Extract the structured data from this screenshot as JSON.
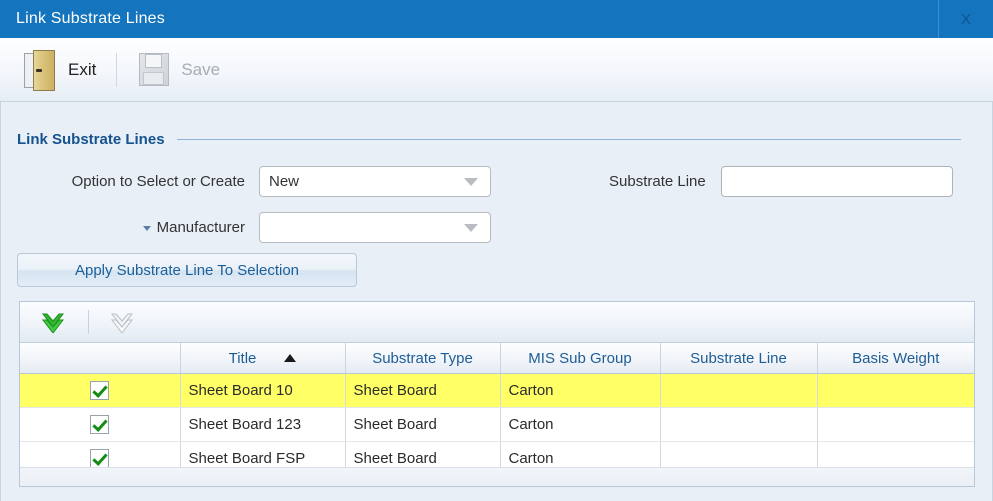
{
  "window": {
    "title": "Link Substrate Lines",
    "close_label": "X",
    "accent_color": "#1474bd",
    "body_background": "#e8eff7"
  },
  "toolbar": {
    "exit_label": "Exit",
    "exit_icon": "door-open-icon",
    "save_label": "Save",
    "save_icon": "floppy-disk-icon",
    "save_disabled": true
  },
  "form": {
    "section_title": "Link Substrate Lines",
    "option_label": "Option to Select or Create",
    "option_value": "New",
    "manufacturer_label": "Manufacturer",
    "manufacturer_value": "",
    "substrate_line_label": "Substrate Line",
    "substrate_line_value": "",
    "substrate_line_placeholder": "",
    "apply_button_label": "Apply Substrate Line To Selection"
  },
  "grid": {
    "toolbar": {
      "select_all_icon": "double-check-green-icon",
      "deselect_all_icon": "double-check-grey-icon",
      "deselect_all_disabled": true
    },
    "columns": [
      {
        "key": "checkbox",
        "label": ""
      },
      {
        "key": "title",
        "label": "Title",
        "sort": "asc"
      },
      {
        "key": "substrate_type",
        "label": "Substrate Type"
      },
      {
        "key": "mis_sub_group",
        "label": "MIS Sub Group"
      },
      {
        "key": "substrate_line",
        "label": "Substrate Line"
      },
      {
        "key": "basis_weight",
        "label": "Basis Weight"
      }
    ],
    "rows": [
      {
        "checked": true,
        "title": "Sheet Board 10",
        "substrate_type": "Sheet Board",
        "mis_sub_group": "Carton",
        "substrate_line": "",
        "basis_weight": "",
        "selected": true
      },
      {
        "checked": true,
        "title": "Sheet Board 123",
        "substrate_type": "Sheet Board",
        "mis_sub_group": "Carton",
        "substrate_line": "",
        "basis_weight": "",
        "selected": false
      },
      {
        "checked": true,
        "title": "Sheet Board FSP",
        "substrate_type": "Sheet Board",
        "mis_sub_group": "Carton",
        "substrate_line": "",
        "basis_weight": "",
        "selected": false
      }
    ]
  }
}
